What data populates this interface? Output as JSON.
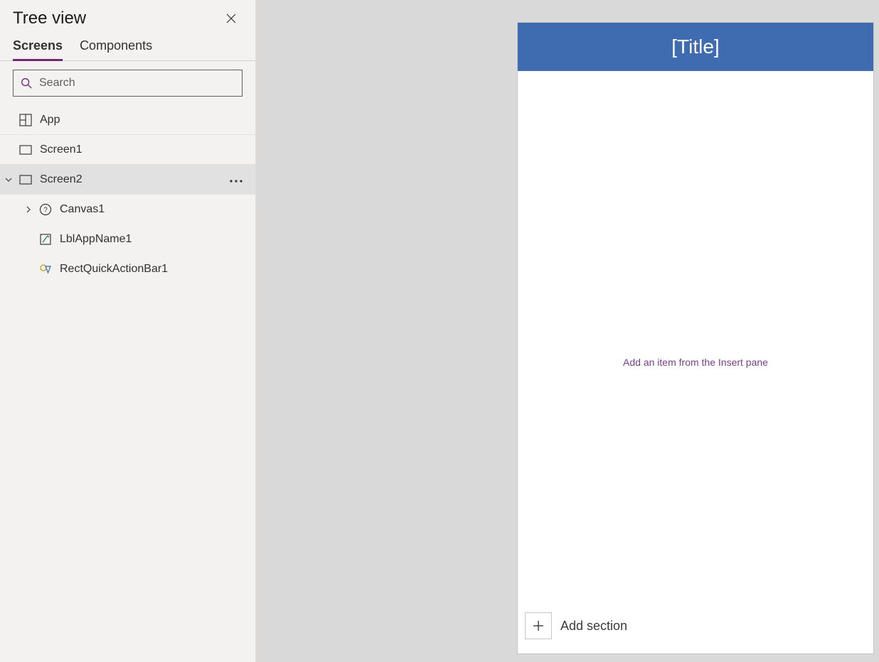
{
  "panel": {
    "title": "Tree view",
    "tabs": {
      "screens": "Screens",
      "components": "Components"
    },
    "search": {
      "placeholder": "Search"
    },
    "items": {
      "app": "App",
      "screen1": "Screen1",
      "screen2": "Screen2",
      "canvas1": "Canvas1",
      "lblAppName1": "LblAppName1",
      "rectQuickActionBar1": "RectQuickActionBar1"
    }
  },
  "canvas": {
    "title": "[Title]",
    "hint": "Add an item from the Insert pane",
    "addSection": "Add section"
  }
}
